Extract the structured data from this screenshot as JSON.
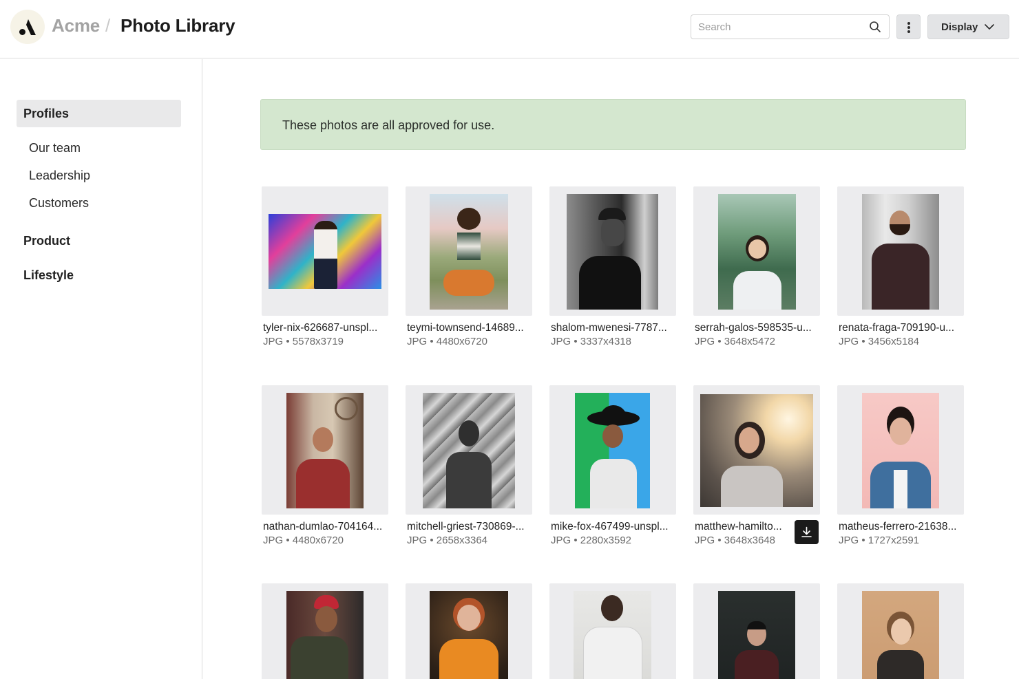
{
  "header": {
    "brand": "Acme",
    "separator": "/",
    "title": "Photo Library",
    "search_placeholder": "Search",
    "display_label": "Display"
  },
  "sidebar": {
    "items": [
      {
        "label": "Profiles"
      },
      {
        "label": "Our team"
      },
      {
        "label": "Leadership"
      },
      {
        "label": "Customers"
      },
      {
        "label": "Product"
      },
      {
        "label": "Lifestyle"
      }
    ]
  },
  "banner": {
    "message": "These photos are all approved for use.",
    "color": "#d4e7cf"
  },
  "photos": [
    {
      "name": "tyler-nix-626687-unspl...",
      "info": "JPG • 5578x3719"
    },
    {
      "name": "teymi-townsend-14689...",
      "info": "JPG • 4480x6720"
    },
    {
      "name": "shalom-mwenesi-7787...",
      "info": "JPG • 3337x4318"
    },
    {
      "name": "serrah-galos-598535-u...",
      "info": "JPG • 3648x5472"
    },
    {
      "name": "renata-fraga-709190-u...",
      "info": "JPG • 3456x5184"
    },
    {
      "name": "nathan-dumlao-704164...",
      "info": "JPG • 4480x6720"
    },
    {
      "name": "mitchell-griest-730869-...",
      "info": "JPG • 2658x3364"
    },
    {
      "name": "mike-fox-467499-unspl...",
      "info": "JPG • 2280x3592"
    },
    {
      "name": "matthew-hamilto...",
      "info": "JPG • 3648x3648"
    },
    {
      "name": "matheus-ferrero-21638...",
      "info": "JPG • 1727x2591"
    },
    {
      "name": "",
      "info": ""
    },
    {
      "name": "",
      "info": ""
    },
    {
      "name": "",
      "info": ""
    },
    {
      "name": "",
      "info": ""
    },
    {
      "name": "",
      "info": ""
    }
  ],
  "icons": {
    "search": "search-icon",
    "more": "more-vertical-icon",
    "chevron": "chevron-down-icon",
    "download": "download-icon",
    "logo": "acme-logo-icon"
  }
}
